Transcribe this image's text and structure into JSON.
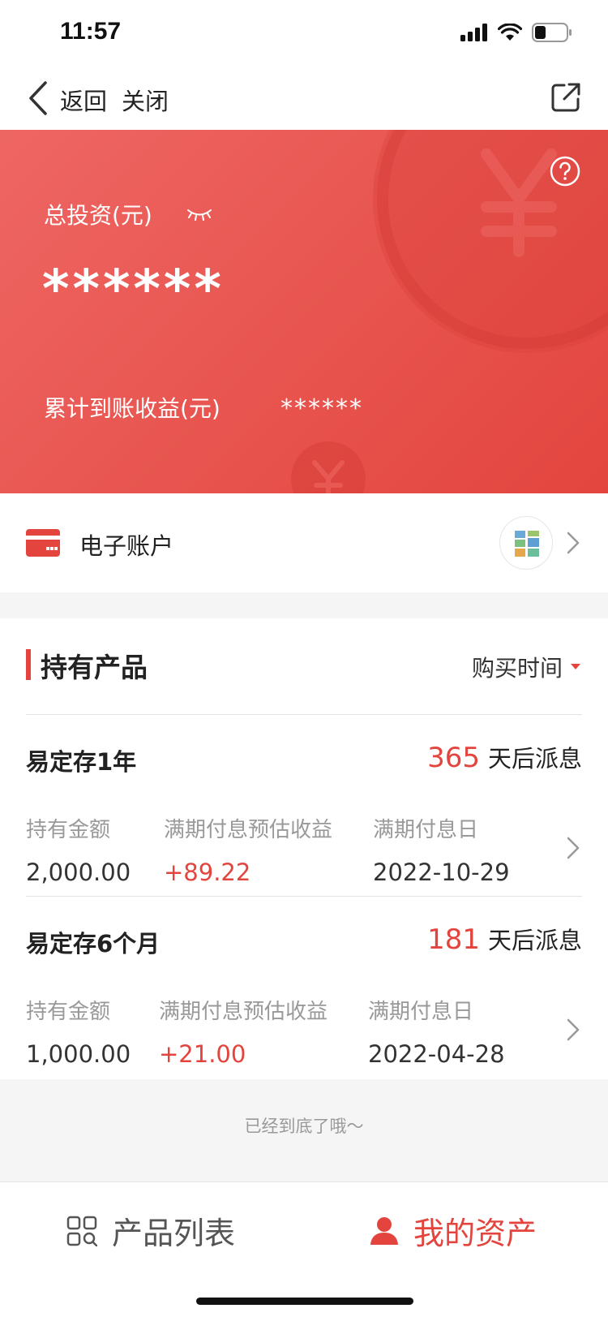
{
  "status_bar": {
    "time": "11:57"
  },
  "nav": {
    "back_label": "返回",
    "close_label": "关闭"
  },
  "hero": {
    "total_label": "总投资(元)",
    "total_value": "******",
    "earnings_label": "累计到账收益(元)",
    "earnings_value": "******"
  },
  "account": {
    "label": "电子账户"
  },
  "holdings": {
    "title": "持有产品",
    "sort_label": "购买时间",
    "products": [
      {
        "name": "易定存1年",
        "days": "365",
        "days_suffix": "天后派息",
        "amount_label": "持有金额",
        "amount": "2,000.00",
        "interest_label": "满期付息预估收益",
        "interest": "+89.22",
        "date_label": "满期付息日",
        "date": "2022-10-29"
      },
      {
        "name": "易定存6个月",
        "days": "181",
        "days_suffix": "天后派息",
        "amount_label": "持有金额",
        "amount": "1,000.00",
        "interest_label": "满期付息预估收益",
        "interest": "+21.00",
        "date_label": "满期付息日",
        "date": "2022-04-28"
      }
    ]
  },
  "bottom_tip": "已经到底了哦～",
  "tabs": [
    {
      "label": "产品列表",
      "icon": "grid-search-icon",
      "active": false
    },
    {
      "label": "我的资产",
      "icon": "user-icon",
      "active": true
    }
  ],
  "colors": {
    "accent": "#e3453e",
    "hero_start": "#ee6663",
    "hero_end": "#e3453e"
  }
}
